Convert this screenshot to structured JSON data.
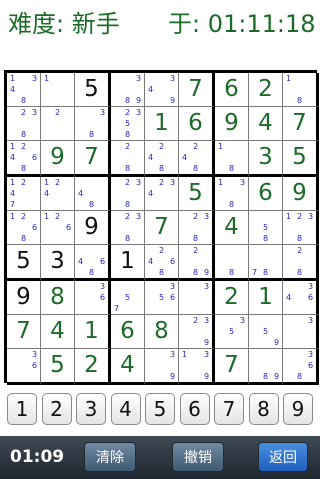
{
  "header": {
    "difficulty": "难度: 新手",
    "timer": "于: 01:11:18"
  },
  "board": {
    "given_color": "#111111",
    "user_color": "#1d6b2a",
    "note_color": "#2828b8",
    "cells": [
      [
        {
          "notes": [
            "1",
            "3",
            "4",
            "8"
          ]
        },
        {
          "notes": [
            "1"
          ]
        },
        {
          "v": "5",
          "g": true
        },
        {
          "notes": [
            "3",
            "8",
            "9"
          ]
        },
        {
          "notes": [
            "3",
            "4",
            "9"
          ]
        },
        {
          "v": "7",
          "g": false
        },
        {
          "v": "6",
          "g": false
        },
        {
          "v": "2",
          "g": false
        },
        {
          "notes": [
            "1",
            "8"
          ]
        }
      ],
      [
        {
          "notes": [
            "2",
            "3",
            "8"
          ]
        },
        {
          "notes": [
            "2"
          ]
        },
        {
          "notes": [
            "3",
            "8"
          ]
        },
        {
          "notes": [
            "2",
            "3",
            "5",
            "8"
          ]
        },
        {
          "v": "1",
          "g": false
        },
        {
          "v": "6",
          "g": false
        },
        {
          "v": "9",
          "g": false
        },
        {
          "v": "4",
          "g": false
        },
        {
          "v": "7",
          "g": false
        }
      ],
      [
        {
          "notes": [
            "1",
            "2",
            "4",
            "6",
            "8"
          ]
        },
        {
          "v": "9",
          "g": false
        },
        {
          "v": "7",
          "g": false
        },
        {
          "notes": [
            "2",
            "8"
          ]
        },
        {
          "notes": [
            "2",
            "4",
            "8"
          ]
        },
        {
          "notes": [
            "2",
            "4",
            "8"
          ]
        },
        {
          "notes": [
            "1",
            "8"
          ]
        },
        {
          "v": "3",
          "g": false
        },
        {
          "v": "5",
          "g": false
        }
      ],
      [
        {
          "notes": [
            "1",
            "2",
            "4",
            "7"
          ]
        },
        {
          "notes": [
            "1",
            "2",
            "4"
          ]
        },
        {
          "notes": [
            "4",
            "8"
          ]
        },
        {
          "notes": [
            "2",
            "3",
            "8"
          ]
        },
        {
          "notes": [
            "2",
            "3",
            "4"
          ]
        },
        {
          "v": "5",
          "g": false
        },
        {
          "notes": [
            "1",
            "3",
            "8"
          ]
        },
        {
          "v": "6",
          "g": false
        },
        {
          "v": "9",
          "g": false
        }
      ],
      [
        {
          "notes": [
            "1",
            "2",
            "6",
            "8"
          ]
        },
        {
          "notes": [
            "1",
            "2",
            "6"
          ]
        },
        {
          "v": "9",
          "g": true
        },
        {
          "notes": [
            "2",
            "3",
            "8"
          ]
        },
        {
          "v": "7",
          "g": false
        },
        {
          "notes": [
            "2",
            "3",
            "8"
          ]
        },
        {
          "v": "4",
          "g": false
        },
        {
          "notes": [
            "5",
            "8"
          ]
        },
        {
          "notes": [
            "1",
            "2",
            "3",
            "8"
          ]
        }
      ],
      [
        {
          "v": "5",
          "g": true
        },
        {
          "v": "3",
          "g": true
        },
        {
          "notes": [
            "4",
            "6",
            "8"
          ]
        },
        {
          "v": "1",
          "g": true
        },
        {
          "notes": [
            "2",
            "4",
            "6",
            "8"
          ]
        },
        {
          "notes": [
            "2",
            "8",
            "9"
          ]
        },
        {
          "notes": [
            "8"
          ]
        },
        {
          "notes": [
            "7",
            "8"
          ]
        },
        {
          "notes": [
            "2",
            "8"
          ]
        }
      ],
      [
        {
          "v": "9",
          "g": true
        },
        {
          "v": "8",
          "g": false
        },
        {
          "notes": [
            "3",
            "6"
          ]
        },
        {
          "notes": [
            "5",
            "7"
          ]
        },
        {
          "notes": [
            "3",
            "5",
            "6"
          ]
        },
        {
          "notes": [
            "3"
          ]
        },
        {
          "v": "2",
          "g": false
        },
        {
          "v": "1",
          "g": false
        },
        {
          "notes": [
            "3",
            "4",
            "6"
          ]
        }
      ],
      [
        {
          "v": "7",
          "g": false
        },
        {
          "v": "4",
          "g": false
        },
        {
          "v": "1",
          "g": false
        },
        {
          "v": "6",
          "g": false
        },
        {
          "v": "8",
          "g": false
        },
        {
          "notes": [
            "2",
            "3",
            "9"
          ]
        },
        {
          "notes": [
            "3",
            "5"
          ]
        },
        {
          "notes": [
            "5",
            "9"
          ]
        },
        {
          "notes": [
            "3"
          ]
        }
      ],
      [
        {
          "notes": [
            "3",
            "6"
          ]
        },
        {
          "v": "5",
          "g": false
        },
        {
          "v": "2",
          "g": false
        },
        {
          "v": "4",
          "g": false
        },
        {
          "notes": [
            "3",
            "9"
          ]
        },
        {
          "notes": [
            "1",
            "3",
            "9"
          ]
        },
        {
          "v": "7",
          "g": false
        },
        {
          "notes": [
            "8",
            "9"
          ]
        },
        {
          "notes": [
            "3",
            "6",
            "8"
          ]
        }
      ]
    ]
  },
  "numpad": [
    "1",
    "2",
    "3",
    "4",
    "5",
    "6",
    "7",
    "8",
    "9"
  ],
  "bottombar": {
    "elapsed": "01:09",
    "clear_label": "清除",
    "undo_label": "撤销",
    "back_label": "返回"
  },
  "colors": {
    "header_text": "#1d6b2a",
    "bar_top": "#3e4a55",
    "bar_bottom": "#1e2730",
    "accent_button": "#1e5fbe"
  }
}
